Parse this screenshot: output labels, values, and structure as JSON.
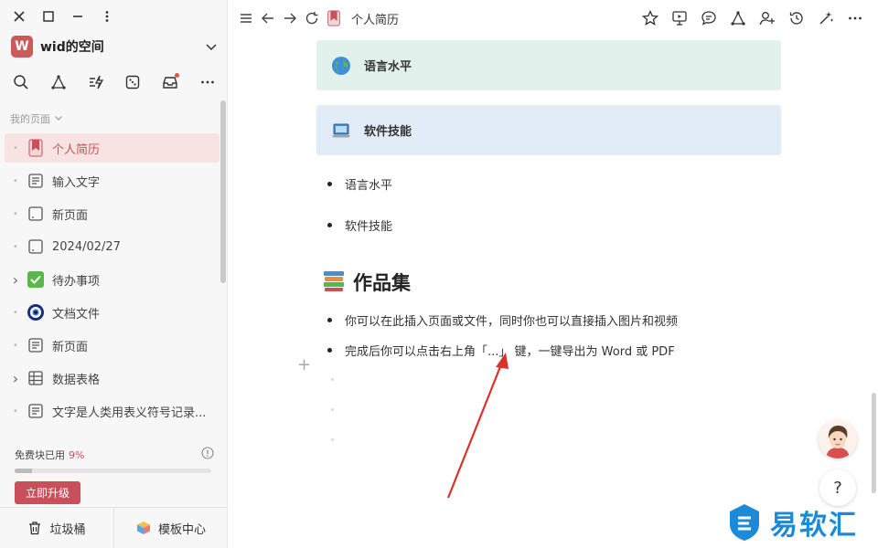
{
  "window": {
    "controls": [
      "close-icon",
      "maximize-icon",
      "minimize-icon",
      "more-vertical-icon"
    ]
  },
  "workspace": {
    "avatar_letter": "W",
    "name": "wid的空间",
    "avatar_color": "#cc5a5a"
  },
  "sidebar_tools": [
    "search-icon",
    "graph-icon",
    "quick-action-icon",
    "dice-icon",
    "inbox-icon",
    "more-icon"
  ],
  "section_label": "我的页面",
  "pages": [
    {
      "label": "个人简历",
      "icon": "bookmark-icon",
      "lead": "•",
      "active": true
    },
    {
      "label": "输入文字",
      "icon": "doc-icon",
      "lead": "•"
    },
    {
      "label": "新页面",
      "icon": "blank-page-icon",
      "lead": "•"
    },
    {
      "label": "2024/02/27",
      "icon": "blank-page-icon",
      "lead": "•"
    },
    {
      "label": "待办事项",
      "icon": "checkbox-icon",
      "lead": "›"
    },
    {
      "label": "文档文件",
      "icon": "eye-icon",
      "lead": "•"
    },
    {
      "label": "新页面",
      "icon": "doc-icon",
      "lead": "•"
    },
    {
      "label": "数据表格",
      "icon": "table-icon",
      "lead": "›"
    },
    {
      "label": "文字是人类用表义符号记录...",
      "icon": "doc-icon",
      "lead": "•"
    }
  ],
  "quota": {
    "label": "免费块已用",
    "percent_text": "9%",
    "percent": 0.09,
    "upgrade_label": "立即升级"
  },
  "bottom": {
    "trash_label": "垃圾桶",
    "templates_label": "模板中心"
  },
  "topbar": {
    "title": "个人简历"
  },
  "content": {
    "callouts": [
      {
        "text": "语言水平",
        "emoji": "globe-icon",
        "bg": "#e2f1ec"
      },
      {
        "text": "软件技能",
        "emoji": "laptop-icon",
        "bg": "#e2ecf6"
      }
    ],
    "bullets_top": [
      "语言水平",
      "软件技能"
    ],
    "heading": "作品集",
    "bullets_bottom": [
      "你可以在此插入页面或文件，同时你也可以直接插入图片和视频",
      "完成后你可以点击右上角「...」 键，一键导出为 Word 或 PDF"
    ]
  },
  "help": {
    "label": "?"
  },
  "watermark": {
    "text": "易软汇",
    "color": "#1c8ad6"
  },
  "colors": {
    "accent": "#c9505a",
    "annotation_arrow": "#d9322b"
  }
}
